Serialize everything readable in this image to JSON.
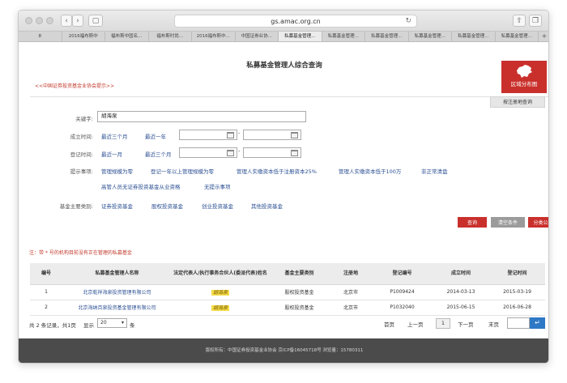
{
  "browser": {
    "url": "gs.amac.org.cn",
    "tabs": [
      "8",
      "2016福布斯中",
      "福布斯中国名...",
      "福布斯时尚...",
      "2016福布斯中...",
      "中国证券业协...",
      "私募基金管理...",
      "私募基金管理...",
      "私募基金管理...",
      "私募基金管理...",
      "私募基金管理...",
      "私募基金管理..."
    ],
    "active_tab": 6
  },
  "page": {
    "title": "私募基金管理人综合查询",
    "hint_link": "<<中国证券投资基金业协会提示>>",
    "region_button": "区域分布图",
    "register_tab": "按注册地查询"
  },
  "form": {
    "keyword_label": "关键字:",
    "keyword_value": "胡海泉",
    "established_label": "成立时间:",
    "established_opts": [
      "最近三个月",
      "最近一年"
    ],
    "registered_label": "登记时间:",
    "registered_opts": [
      "最近一月",
      "最近三个月"
    ],
    "dash": "-",
    "tips_label": "提示事项:",
    "tips_row1": [
      "管理规模为零",
      "登记一年以上管理规模为零",
      "管理人实缴资本低于注册资本25%",
      "管理人实缴资本低于100万",
      "非正常清盘"
    ],
    "tips_row2": [
      "高管人员无证券投资基金从业资格",
      "无提示事项"
    ],
    "category_label": "基金主要类别:",
    "categories": [
      "证券投资基金",
      "股权投资基金",
      "创业投资基金",
      "其他投资基金"
    ]
  },
  "actions": {
    "query": "查询",
    "clear": "清空条件",
    "classify": "分类公示"
  },
  "note": "注：带 * 号的机构目前没有正在管理的私募基金",
  "table": {
    "headers": [
      "编号",
      "私募基金管理人名称",
      "法定代表人/执行事务合伙人(委派代表)姓名",
      "基金主要类别",
      "注册地",
      "登记编号",
      "成立时间",
      "登记时间"
    ],
    "rows": [
      [
        "1",
        "北京乾祥海泉投资管理有限公司",
        "胡海泉",
        "股权投资基金",
        "北京市",
        "P1009424",
        "2014-03-13",
        "2015-03-19"
      ],
      [
        "2",
        "北京海纳百泉投资基金管理有限公司",
        "胡海泉",
        "股权投资基金",
        "北京市",
        "P1032040",
        "2015-06-15",
        "2016-06-28"
      ]
    ]
  },
  "pagination": {
    "summary": "共 2 条记录，共1页",
    "show_label": "显示",
    "page_size": "20",
    "unit": "条",
    "first": "首页",
    "prev": "上一页",
    "current": "1",
    "next": "下一页",
    "last": "末页",
    "go_icon": "arrow-enter-icon"
  },
  "footer": {
    "text": "版权所有：中国证券投资基金业协会 京ICP备16045718号    浏览量：15780311"
  },
  "colors": {
    "accent_red": "#c9302c",
    "link_blue": "#2b4f93",
    "go_blue": "#2e78c6",
    "highlight_yellow": "#f3dc4a"
  }
}
